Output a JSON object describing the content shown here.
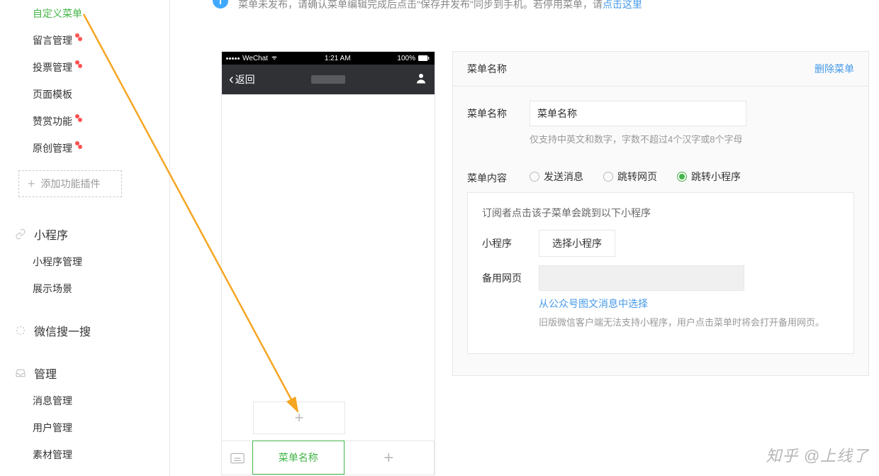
{
  "sidebar": {
    "items": [
      {
        "label": "自定义菜单",
        "dot": false,
        "active": true
      },
      {
        "label": "留言管理",
        "dot": true,
        "active": false
      },
      {
        "label": "投票管理",
        "dot": true,
        "active": false
      },
      {
        "label": "页面模板",
        "dot": false,
        "active": false
      },
      {
        "label": "赞赏功能",
        "dot": true,
        "active": false
      },
      {
        "label": "原创管理",
        "dot": true,
        "active": false
      }
    ],
    "add_plugin": "添加功能插件",
    "sections": [
      {
        "icon": "link-icon",
        "title": "小程序",
        "items": [
          "小程序管理",
          "展示场景"
        ]
      },
      {
        "icon": "sparkle-icon",
        "title": "微信搜一搜",
        "items": []
      },
      {
        "icon": "tray-icon",
        "title": "管理",
        "items": [
          "消息管理",
          "用户管理",
          "素材管理"
        ]
      }
    ]
  },
  "notice": {
    "text_before": "菜单未发布，请确认菜单编辑完成后点击\"保存并发布\"同步到手机。若停用菜单，请",
    "link": "点击这里"
  },
  "phone": {
    "carrier": "WeChat",
    "time": "1:21 AM",
    "battery": "100%",
    "back": "返回",
    "active_menu": "菜单名称",
    "plus": "+"
  },
  "config": {
    "head_title": "菜单名称",
    "delete": "删除菜单",
    "name_label": "菜单名称",
    "name_value": "菜单名称",
    "name_hint": "仅支持中英文和数字，字数不超过4个汉字或8个字母",
    "content_label": "菜单内容",
    "radios": {
      "send": "发送消息",
      "jump_web": "跳转网页",
      "jump_mini": "跳转小程序"
    },
    "mini": {
      "desc": "订阅者点击该子菜单会跳到以下小程序",
      "mp_label": "小程序",
      "mp_choose": "选择小程序",
      "fallback_label": "备用网页",
      "fallback_link": "从公众号图文消息中选择",
      "fallback_hint": "旧版微信客户端无法支持小程序，用户点击菜单时将会打开备用网页。"
    }
  },
  "watermark": "知乎 @上线了"
}
